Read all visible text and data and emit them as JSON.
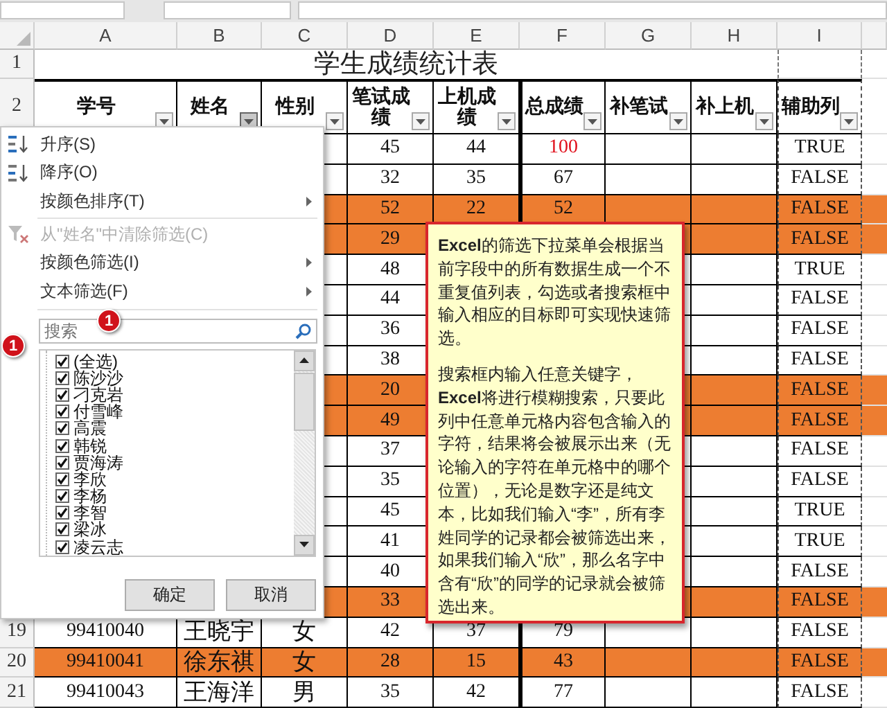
{
  "columns": [
    "A",
    "B",
    "C",
    "D",
    "E",
    "F",
    "G",
    "H",
    "I"
  ],
  "title_row": {
    "row": "1",
    "text": "学生成绩统计表"
  },
  "header_row": {
    "row": "2",
    "cells": [
      {
        "text": "学号",
        "filter_open": false
      },
      {
        "text": "姓名",
        "filter_open": true
      },
      {
        "text": "性别",
        "filter_open": false
      },
      {
        "text": "笔试成绩",
        "filter_open": false
      },
      {
        "text": "上机成绩",
        "filter_open": false
      },
      {
        "text": "总成绩",
        "filter_open": false
      },
      {
        "text": "补笔试",
        "filter_open": false
      },
      {
        "text": "补上机",
        "filter_open": false
      },
      {
        "text": "辅助列",
        "filter_open": false
      }
    ]
  },
  "rows": [
    {
      "highlighted": false,
      "total_flagged": true,
      "cells": {
        "D": "45",
        "E": "44",
        "F": "100",
        "I": "TRUE"
      }
    },
    {
      "highlighted": false,
      "total_flagged": false,
      "cells": {
        "D": "32",
        "E": "35",
        "F": "67",
        "I": "FALSE"
      }
    },
    {
      "highlighted": true,
      "total_flagged": false,
      "cells": {
        "D": "52",
        "E": "22",
        "F": "52",
        "I": "FALSE"
      }
    },
    {
      "highlighted": true,
      "cells": {
        "D": "29",
        "I": "FALSE"
      }
    },
    {
      "highlighted": false,
      "cells": {
        "D": "48",
        "I": "TRUE"
      }
    },
    {
      "highlighted": false,
      "cells": {
        "D": "44",
        "I": "FALSE"
      }
    },
    {
      "highlighted": false,
      "cells": {
        "D": "36",
        "I": "FALSE"
      }
    },
    {
      "highlighted": false,
      "cells": {
        "D": "38",
        "I": "FALSE"
      }
    },
    {
      "highlighted": true,
      "cells": {
        "D": "20",
        "I": "FALSE"
      }
    },
    {
      "highlighted": true,
      "cells": {
        "D": "49",
        "I": "FALSE"
      }
    },
    {
      "highlighted": false,
      "cells": {
        "D": "37",
        "I": "FALSE"
      }
    },
    {
      "highlighted": false,
      "cells": {
        "D": "35",
        "I": "FALSE"
      }
    },
    {
      "highlighted": false,
      "cells": {
        "D": "45",
        "I": "TRUE"
      }
    },
    {
      "highlighted": false,
      "cells": {
        "D": "41",
        "I": "TRUE"
      }
    },
    {
      "highlighted": false,
      "cells": {
        "D": "40",
        "I": "FALSE"
      }
    },
    {
      "highlighted": true,
      "cells": {
        "D": "33",
        "I": "FALSE"
      }
    },
    {
      "row": "19",
      "highlighted": false,
      "total_flagged": false,
      "cells": {
        "A": "99410040",
        "B": "王晓宇",
        "C": "女",
        "D": "42",
        "E": "37",
        "F": "79",
        "I": "FALSE"
      }
    },
    {
      "row": "20",
      "highlighted": true,
      "total_flagged": false,
      "cells": {
        "A": "99410041",
        "B": "徐东祺",
        "C": "女",
        "D": "28",
        "E": "15",
        "F": "43",
        "I": "FALSE"
      }
    },
    {
      "row": "21",
      "highlighted": false,
      "total_flagged": false,
      "cells": {
        "A": "99410043",
        "B": "王海洋",
        "C": "男",
        "D": "35",
        "E": "42",
        "F": "77",
        "I": "FALSE"
      }
    }
  ],
  "filter_menu": {
    "items": [
      {
        "kind": "ascending",
        "label": "升序(S)",
        "submenu": false,
        "disabled": false
      },
      {
        "kind": "descending",
        "label": "降序(O)",
        "submenu": false,
        "disabled": false
      },
      {
        "kind": "plain",
        "label": "按颜色排序(T)",
        "submenu": true,
        "disabled": false
      },
      {
        "kind": "clear",
        "label": "从\"姓名\"中清除筛选(C)",
        "submenu": false,
        "disabled": true
      },
      {
        "kind": "plain",
        "label": "按颜色筛选(I)",
        "submenu": true,
        "disabled": false
      },
      {
        "kind": "plain",
        "label": "文本筛选(F)",
        "submenu": true,
        "disabled": false
      }
    ],
    "search": {
      "placeholder": "搜索"
    },
    "search_badge": "1",
    "list_badge": "1",
    "values": [
      {
        "label": "(全选)",
        "checked": true
      },
      {
        "label": "陈沙沙",
        "checked": true
      },
      {
        "label": "刁克岩",
        "checked": true
      },
      {
        "label": "付雪峰",
        "checked": true
      },
      {
        "label": "高震",
        "checked": true
      },
      {
        "label": "韩锐",
        "checked": true
      },
      {
        "label": "贾海涛",
        "checked": true
      },
      {
        "label": "李欣",
        "checked": true
      },
      {
        "label": "李杨",
        "checked": true
      },
      {
        "label": "李智",
        "checked": true
      },
      {
        "label": "梁冰",
        "checked": true
      },
      {
        "label": "凌云志",
        "checked": true
      }
    ],
    "buttons": [
      "确定",
      "取消"
    ]
  },
  "callout": {
    "paragraphs": [
      "**Excel**的筛选下拉菜单会根据当前字段中的所有数据生成一个不重复值列表，勾选或者搜索框中输入相应的目标即可实现快速筛选。",
      "搜索框内输入任意关键字，**Excel**将进行模糊搜索，只要此列中任意单元格内容包含输入的字符，结果将会被展示出来（无论输入的字符在单元格中的哪个位置），无论是数字还是纯文本，比如我们输入“李”，所有李姓同学的记录都会被筛选出来，如果我们输入“欣”，那么名字中含有“欣”的同学的记录就会被筛选出来。"
    ]
  }
}
